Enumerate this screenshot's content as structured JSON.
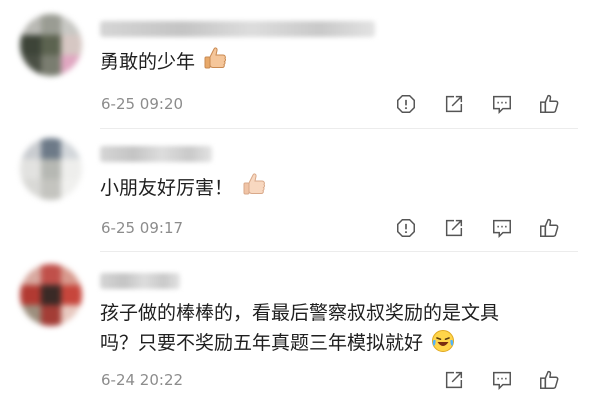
{
  "comments": [
    {
      "text": "勇敢的少年",
      "time": "6-25 09:20",
      "emoji": "thumbs-up-icon",
      "has_report": true
    },
    {
      "text": "小朋友好厉害！",
      "time": "6-25 09:17",
      "emoji": "thumbs-up-icon",
      "has_report": true
    },
    {
      "text_line1": "孩子做的棒棒的，看最后警察叔叔奖励的是文具",
      "text_line2": "吗？只要不奖励五年真题三年模拟就好",
      "time": "6-24 20:22",
      "emoji": "laughing-crying-icon",
      "has_report": false
    }
  ],
  "colors": {
    "text": "#1f1f1f",
    "time": "#8c8c8c",
    "icon": "#555555",
    "divider": "#ececec"
  }
}
